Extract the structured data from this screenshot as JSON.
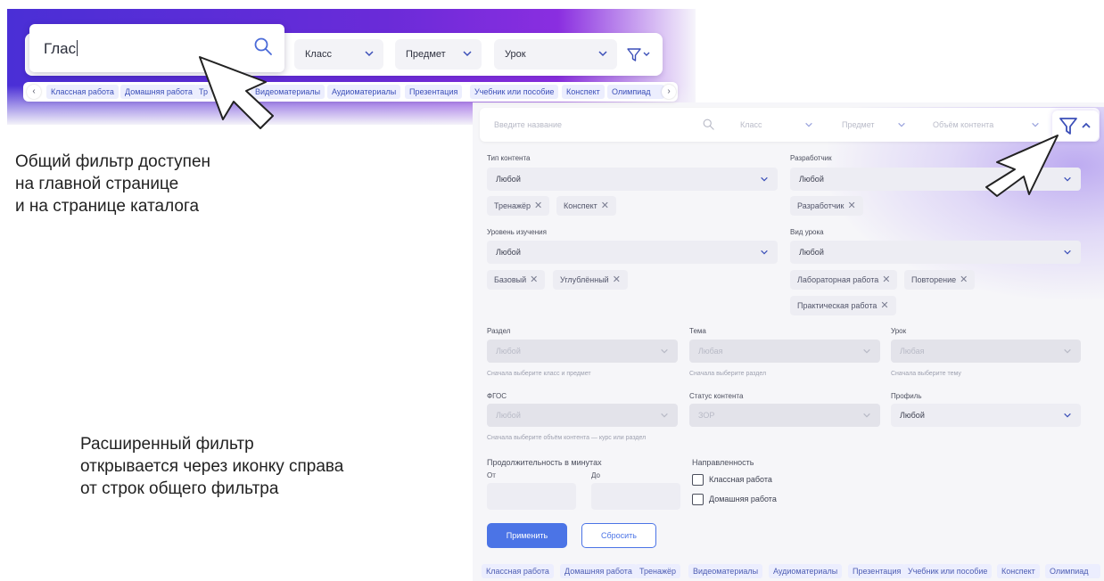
{
  "top_filter": {
    "search_value": "Глас",
    "selects": [
      {
        "label": "Класс"
      },
      {
        "label": "Предмет"
      },
      {
        "label": "Урок"
      }
    ],
    "chips": [
      "Классная работа",
      "Домашняя работа",
      "Тр",
      "Видеоматериалы",
      "Аудиоматериалы",
      "Презентация",
      "Учебник или пособие",
      "Конспект",
      "Олимпиад"
    ],
    "chip_prev": "‹",
    "chip_next": "›"
  },
  "captions": {
    "general": [
      "Общий фильтр доступен",
      "на главной странице",
      "и на странице каталога"
    ],
    "extended": [
      "Расширенный фильтр",
      "открывается через иконку справа",
      "от строк общего фильтра"
    ]
  },
  "ext_filter": {
    "search_placeholder": "Введите название",
    "selects": [
      {
        "label": "Класс"
      },
      {
        "label": "Предмет"
      },
      {
        "label": "Объём контента"
      }
    ],
    "content_type": {
      "label": "Тип контента",
      "value": "Любой",
      "tags": [
        "Тренажёр",
        "Конспект"
      ]
    },
    "developer": {
      "label": "Разработчик",
      "value": "Любой",
      "tags": [
        "Разработчик"
      ]
    },
    "study_level": {
      "label": "Уровень изучения",
      "value": "Любой",
      "tags": [
        "Базовый",
        "Углублённый"
      ]
    },
    "lesson_kind": {
      "label": "Вид урока",
      "value": "Любой",
      "tags": [
        "Лабораторная работа",
        "Повторение",
        "Практическая работа"
      ]
    },
    "section": {
      "label": "Раздел",
      "value": "Любой",
      "hint": "Сначала выберите класс и предмет"
    },
    "topic": {
      "label": "Тема",
      "value": "Любая",
      "hint": "Сначала выберите раздел"
    },
    "lesson": {
      "label": "Урок",
      "value": "Любая",
      "hint": "Сначала выберите тему"
    },
    "fgos": {
      "label": "ФГОС",
      "value": "Любой",
      "hint": "Сначала выберите объём контента — курс или раздел"
    },
    "status": {
      "label": "Статус контента",
      "value": "ЗОР"
    },
    "profile": {
      "label": "Профиль",
      "value": "Любой"
    },
    "duration": {
      "label": "Продолжительность в минутах",
      "from": "От",
      "to": "До"
    },
    "direction": {
      "label": "Направленность",
      "options": [
        "Классная работа",
        "Домашняя работа"
      ]
    },
    "apply_label": "Применить",
    "reset_label": "Сбросить",
    "tag_remove": "✕",
    "chips": [
      "Классная работа",
      "Домашняя работа",
      "Тренажёр",
      "Видеоматериалы",
      "Аудиоматериалы",
      "Презентация",
      "Учебник или пособие",
      "Конспект",
      "Олимпиад"
    ]
  },
  "colors": {
    "primary": "#4b74e6",
    "header_gradient_start": "#4a2fd6",
    "header_gradient_end": "#8a2ee0"
  }
}
